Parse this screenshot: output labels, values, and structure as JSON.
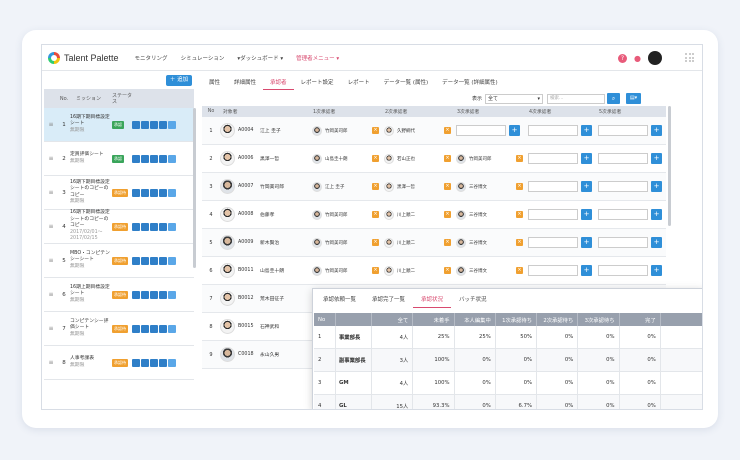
{
  "nav": {
    "logo": "Talent Palette",
    "items": [
      "モニタリング",
      "シミュレーション",
      "▾ダッシュボード ▾",
      "管理者メニュー ▾"
    ],
    "help": "?"
  },
  "left": {
    "add_label": "＋ 追加",
    "headers": {
      "no": "No.",
      "mission": "ミッション",
      "status": "ステータス"
    },
    "rows": [
      {
        "no": "1",
        "mission": "16期下期目標設定シート",
        "sub": "無期限",
        "badge": "承認",
        "badge_color": "#3aa55b"
      },
      {
        "no": "2",
        "mission": "定買評価シート",
        "sub": "無期限",
        "badge": "承認",
        "badge_color": "#3aa55b"
      },
      {
        "no": "3",
        "mission": "16期下期目標設定シートのコピーのコピー",
        "sub": "無期限",
        "badge": "承認待",
        "badge_color": "#f0a030"
      },
      {
        "no": "4",
        "mission": "16期下期目標設定シートのコピーのコピー",
        "sub": "2017/02/01〜2017/02/15",
        "badge": "承認待",
        "badge_color": "#f0a030"
      },
      {
        "no": "5",
        "mission": "MBO・コンピテンシーシート",
        "sub": "無期限",
        "badge": "承認待",
        "badge_color": "#f0a030"
      },
      {
        "no": "6",
        "mission": "16期上期目標設定シート",
        "sub": "無期限",
        "badge": "承認待",
        "badge_color": "#f0a030"
      },
      {
        "no": "7",
        "mission": "コンピテンシー評価シート",
        "sub": "無期限",
        "badge": "承認待",
        "badge_color": "#f0a030"
      },
      {
        "no": "8",
        "mission": "人事考課表",
        "sub": "無期限",
        "badge": "承認待",
        "badge_color": "#f0a030"
      }
    ]
  },
  "tabs": [
    "属性",
    "詳細属性",
    "承認者",
    "レポート設定",
    "レポート",
    "データ一覧 (属性)",
    "データ一覧 (詳細属性)"
  ],
  "filter": {
    "label": "表示",
    "value": "全て",
    "placeholder": "検索..."
  },
  "table": {
    "headers": [
      "No",
      "対象者",
      "1次承認者",
      "2次承認者",
      "3次承認者",
      "4次承認者",
      "5次承認者"
    ],
    "rows": [
      {
        "no": "1",
        "code": "A0004",
        "name": "江上 圭子",
        "a1": "竹岡美司郎",
        "a2": "久野綱代",
        "dark": false
      },
      {
        "no": "2",
        "code": "A0006",
        "name": "黒澤一哲",
        "a1": "山島圭十朗",
        "a2": "若山正也",
        "a3": "竹岡美司郎",
        "dark": false
      },
      {
        "no": "3",
        "code": "A0007",
        "name": "竹岡美司郎",
        "a1": "江上 圭子",
        "a2": "黒澤一哲",
        "a3": "三谷博文",
        "dark": true
      },
      {
        "no": "4",
        "code": "A0008",
        "name": "伯藤孝",
        "a1": "竹岡美司郎",
        "a2": "川上順二",
        "a3": "三谷博文",
        "dark": false
      },
      {
        "no": "5",
        "code": "A0009",
        "name": "新木賢治",
        "a1": "竹岡美司郎",
        "a2": "川上順二",
        "a3": "三谷博文",
        "dark": true
      },
      {
        "no": "6",
        "code": "B0011",
        "name": "山島圭十朗",
        "a1": "竹岡美司郎",
        "a2": "川上順二",
        "a3": "三谷博文",
        "dark": false
      },
      {
        "no": "7",
        "code": "B0012",
        "name": "荒木田征子",
        "dark": false
      },
      {
        "no": "8",
        "code": "B0015",
        "name": "石神武和",
        "dark": false
      },
      {
        "no": "9",
        "code": "C0018",
        "name": "永山久男",
        "dark": true
      }
    ]
  },
  "popup": {
    "tabs": [
      "承認依頼一覧",
      "承認完了一覧",
      "承認状況",
      "バッチ状況"
    ],
    "headers": [
      "No",
      "",
      "全て",
      "未着手",
      "本人編集中",
      "1次承認待ち",
      "2次承認待ち",
      "3次承認待ち",
      "完了"
    ],
    "rows": [
      {
        "no": "1",
        "name": "事業部長",
        "vals": [
          "4人",
          "25%",
          "25%",
          "50%",
          "0%",
          "0%",
          "0%"
        ]
      },
      {
        "no": "2",
        "name": "副事業部長",
        "vals": [
          "3人",
          "100%",
          "0%",
          "0%",
          "0%",
          "0%",
          "0%"
        ]
      },
      {
        "no": "3",
        "name": "GM",
        "vals": [
          "4人",
          "100%",
          "0%",
          "0%",
          "0%",
          "0%",
          "0%"
        ]
      },
      {
        "no": "4",
        "name": "GL",
        "vals": [
          "15人",
          "93.3%",
          "0%",
          "6.7%",
          "0%",
          "0%",
          "0%"
        ]
      }
    ]
  },
  "colors": {
    "accent": "#d84a6f",
    "primary": "#2f8fd8",
    "pending": "#f0a030",
    "approved": "#3aa55b"
  }
}
